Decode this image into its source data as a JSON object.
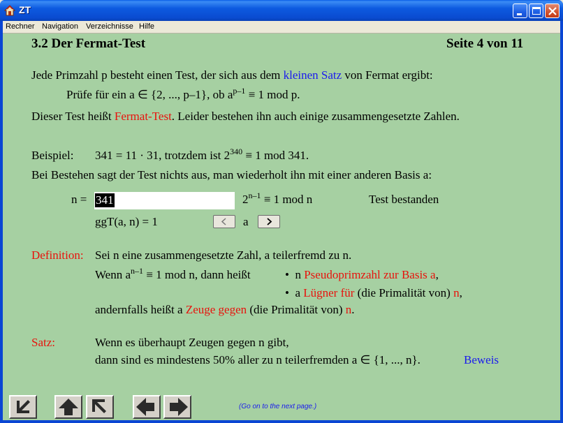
{
  "window": {
    "title": "ZT"
  },
  "menu": [
    "Rechner",
    "Navigation",
    "Verzeichnisse",
    "Hilfe"
  ],
  "page": {
    "section_title": "3.2 Der Fermat-Test",
    "page_indicator": "Seite 4 von 11"
  },
  "intro": {
    "line1_pre": "Jede Primzahl p besteht einen Test, der sich aus dem ",
    "line1_link": "kleinen Satz",
    "line1_post": " von Fermat ergibt:",
    "line2_pre": "Prüfe für ein a ∈ {2, ..., p–1}, ob  a",
    "line2_exp": "p–1",
    "line2_post": " ≡ 1 mod p.",
    "line3_pre": "Dieser Test heißt ",
    "line3_term": "Fermat-Test",
    "line3_post": ". Leider bestehen ihn auch einige zusammengesetzte Zahlen."
  },
  "example": {
    "label": "Beispiel:",
    "text_pre": "341 = 11 · 31,  trotzdem ist  2",
    "text_exp": "340",
    "text_post": " ≡ 1 mod 341.",
    "line2": "Bei Bestehen sagt der Test nichts aus, man wiederholt ihn mit einer anderen Basis a:"
  },
  "calculator": {
    "n_label": "n =",
    "n_value": "341",
    "formula_base": "2",
    "formula_exp": "n–1",
    "formula_post": " ≡ 1 mod n",
    "result": "Test bestanden",
    "ggt": "ggT(a, n) = 1",
    "a_label": "a"
  },
  "definition": {
    "label": "Definition:",
    "line1": "Sei n eine zusammengesetzte Zahl, a teilerfremd zu n.",
    "line2_pre": "Wenn  a",
    "line2_exp": "n–1",
    "line2_post": " ≡ 1 mod n,  dann heißt",
    "bullet1_pre": "n ",
    "bullet1_term": "Pseudoprimzahl zur Basis a",
    "bullet1_post": ",",
    "bullet2_pre": "a ",
    "bullet2_term": "Lügner für",
    "bullet2_mid": " (die Primalität von) ",
    "bullet2_n": "n",
    "bullet2_post": ",",
    "line3_pre": "andernfalls heißt a ",
    "line3_term": "Zeuge gegen",
    "line3_mid": " (die Primalität von) ",
    "line3_n": "n",
    "line3_post": "."
  },
  "theorem": {
    "label": "Satz:",
    "line1": "Wenn es überhaupt Zeugen gegen n gibt,",
    "line2": "dann sind es mindestens 50% aller zu n teilerfremden a ∈ {1, ..., n}.",
    "proof_link": "Beweis"
  },
  "footer": {
    "hint": "(Go on to the next page.)"
  },
  "icons": {
    "app": "app-icon",
    "min": "minimize-icon",
    "max": "maximize-icon",
    "close": "close-icon",
    "nav": [
      "arrow-down-left-icon",
      "arrow-up-icon",
      "arrow-up-left-icon",
      "arrow-left-icon",
      "arrow-right-icon"
    ]
  },
  "colors": {
    "background": "#a6d0a2",
    "link": "#1a1aee",
    "term": "#e8120c"
  }
}
